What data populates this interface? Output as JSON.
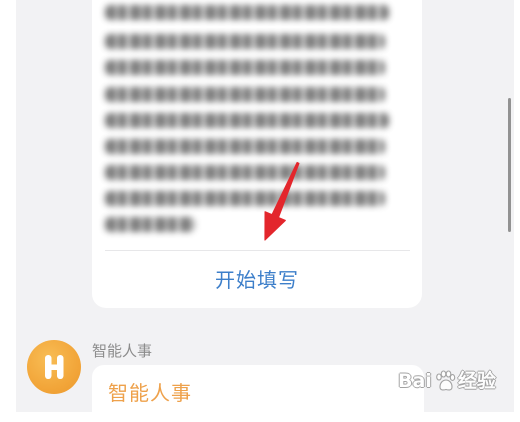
{
  "form_card": {
    "start_button_label": "开始填写"
  },
  "message": {
    "sender_name": "智能人事",
    "bubble_title": "智能人事"
  },
  "watermark": {
    "brand_left": "Bai",
    "brand_right": "经验"
  },
  "icons": {
    "avatar_logo": "h-logo-icon",
    "annotation_arrow": "red-arrow-icon",
    "watermark_logo": "paw-icon"
  },
  "colors": {
    "background": "#f2f2f4",
    "card": "#ffffff",
    "link_blue": "#3d7fca",
    "accent_orange": "#eea14b",
    "arrow_red": "#e3262c",
    "avatar_orange": "#f2a63a",
    "muted_text": "#8c8c8c"
  }
}
